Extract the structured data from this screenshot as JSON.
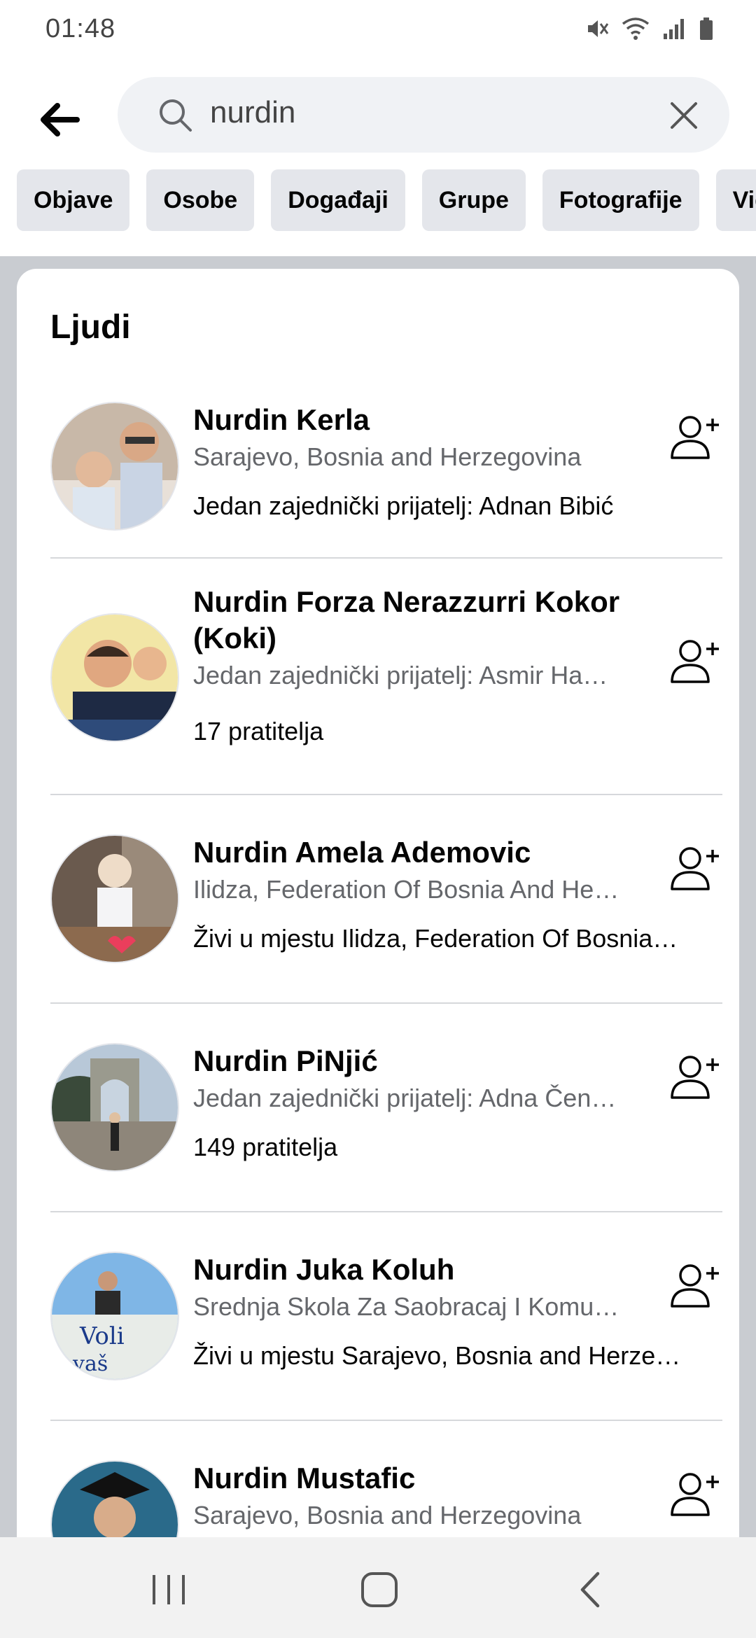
{
  "status_bar": {
    "time": "01:48",
    "icons": [
      "mute-icon",
      "wifi-icon",
      "signal-icon",
      "battery-icon"
    ]
  },
  "search": {
    "query": "nurdin",
    "icons": [
      "back-arrow-icon",
      "search-icon",
      "clear-icon"
    ]
  },
  "filters": [
    "Objave",
    "Osobe",
    "Događaji",
    "Grupe",
    "Fotografije",
    "Vid"
  ],
  "section": {
    "title": "Ljudi"
  },
  "people": [
    {
      "name": "Nurdin Kerla",
      "subtitle": "Sarajevo, Bosnia and Herzegovina",
      "extra": "Jedan zajednički prijatelj: Adnan Bibić"
    },
    {
      "name": "Nurdin Forza Nerazzurri Kokor (Koki)",
      "subtitle": "Jedan zajednički prijatelj: Asmir Ha…",
      "extra": "17 pratitelja"
    },
    {
      "name": "Nurdin Amela Ademovic",
      "subtitle": "Ilidza, Federation Of Bosnia And He…",
      "extra": "Živi u mjestu Ilidza, Federation Of Bosnia…"
    },
    {
      "name": "Nurdin PiNjić",
      "subtitle": "Jedan zajednički prijatelj: Adna Čen…",
      "extra": "149 pratitelja"
    },
    {
      "name": "Nurdin Juka Koluh",
      "subtitle": "Srednja Skola Za Saobracaj I Komu…",
      "extra": "Živi u mjestu Sarajevo, Bosnia and Herze…"
    },
    {
      "name": "Nurdin Mustafic",
      "subtitle": "Sarajevo, Bosnia and Herzegovina",
      "extra": ""
    }
  ],
  "colors": {
    "accent": "#1877f2",
    "text_primary": "#050505",
    "text_secondary": "#65676b",
    "chip_bg": "#e4e6eb",
    "page_bg": "#c9ccd1"
  },
  "nav_bar": {
    "icons": [
      "recents-icon",
      "home-icon",
      "back-icon"
    ]
  }
}
